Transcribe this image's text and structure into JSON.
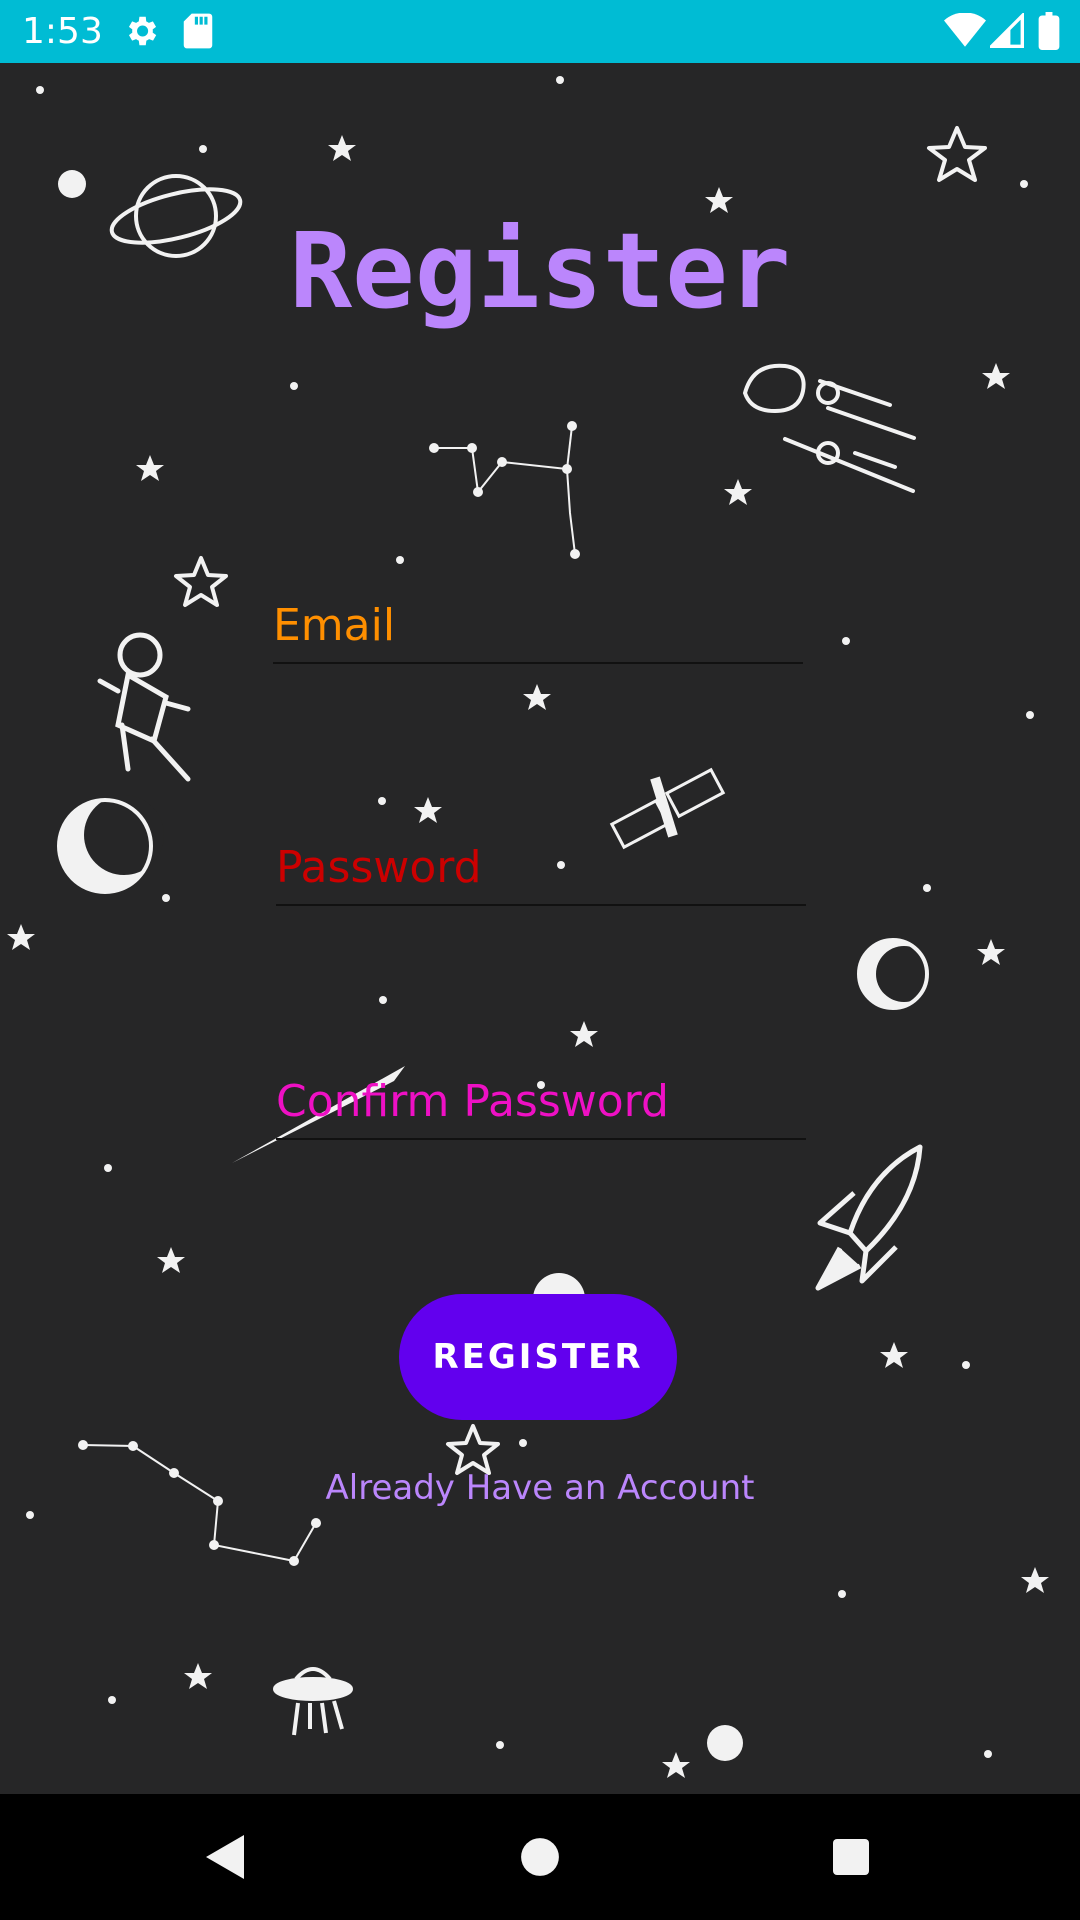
{
  "status_bar": {
    "time": "1:53",
    "background": "#00bcd4",
    "icons": [
      "settings-icon",
      "sd-card-icon",
      "wifi-icon",
      "signal-icon",
      "battery-icon"
    ]
  },
  "screen": {
    "title": "Register",
    "background": "#262627",
    "accent": "#6200ee"
  },
  "form": {
    "email_placeholder": "Email",
    "password_placeholder": "Password",
    "confirm_placeholder": "Confirm Password",
    "register_label": "REGISTER",
    "login_link": "Already Have an Account"
  },
  "nav_bar": {
    "icons": [
      "back-icon",
      "home-icon",
      "recents-icon"
    ]
  }
}
